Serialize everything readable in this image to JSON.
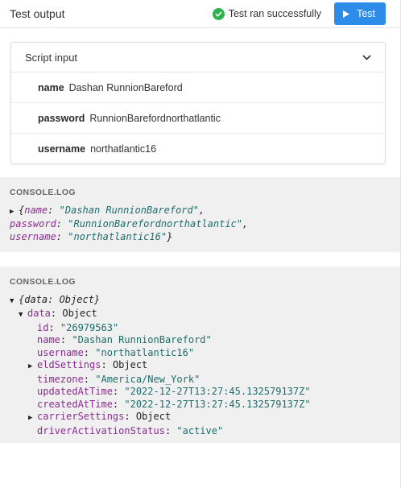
{
  "header": {
    "title": "Test output",
    "status_text": "Test ran successfully",
    "test_button_label": "Test",
    "success_color": "#2fb24f",
    "button_color": "#2d8ce8"
  },
  "script_input": {
    "title": "Script input",
    "fields": [
      {
        "key": "name",
        "value": "Dashan RunnionBareford"
      },
      {
        "key": "password",
        "value": "RunnionBarefordnorthatlantic"
      },
      {
        "key": "username",
        "value": "northatlantic16"
      }
    ]
  },
  "console1": {
    "label": "CONSOLE.LOG",
    "name_value": "\"Dashan RunnionBareford\"",
    "password_value": "\"RunnionBarefordnorthatlantic\"",
    "username_value": "\"northatlantic16\""
  },
  "console2": {
    "label": "CONSOLE.LOG",
    "summary": "{data: Object}",
    "data_type": "Object",
    "id": "\"26979563\"",
    "name": "\"Dashan RunnionBareford\"",
    "username": "\"northatlantic16\"",
    "eldSettings": "Object",
    "timezone": "\"America/New_York\"",
    "updatedAtTime": "\"2022-12-27T13:27:45.132579137Z\"",
    "createdAtTime": "\"2022-12-27T13:27:45.132579137Z\"",
    "carrierSettings": "Object",
    "driverActivationStatus": "\"active\""
  }
}
